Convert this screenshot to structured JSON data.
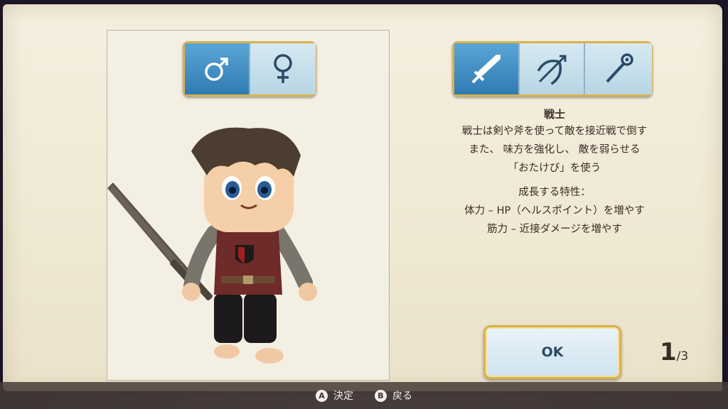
{
  "gender_buttons": {
    "male": {
      "label": "♂",
      "icon": "male-symbol-icon",
      "selected": true
    },
    "female": {
      "label": "♀",
      "icon": "female-symbol-icon",
      "selected": false
    }
  },
  "class_buttons": [
    {
      "icon": "sword-icon",
      "selected": true
    },
    {
      "icon": "bow-icon",
      "selected": false
    },
    {
      "icon": "staff-icon",
      "selected": false
    }
  ],
  "class_info": {
    "name": "戦士",
    "description": [
      "戦士は剣や斧を使って敵を接近戦で倒す",
      "また、 味方を強化し、 敵を弱らせる",
      "「おたけび」を使う"
    ],
    "growth_header": "成長する特性：",
    "growth": [
      "体力 – HP（ヘルスポイント）を増やす",
      "筋力 – 近接ダメージを増やす"
    ]
  },
  "ok_label": "OK",
  "page": {
    "current": "1",
    "total": "/3"
  },
  "hints": [
    {
      "key": "A",
      "label": "決定"
    },
    {
      "key": "B",
      "label": "戻る"
    }
  ],
  "colors": {
    "selected": "#2f7bb4",
    "unselected": "#c6dfeb",
    "frame_gold": "#d9b24e",
    "text": "#3a2c24"
  }
}
